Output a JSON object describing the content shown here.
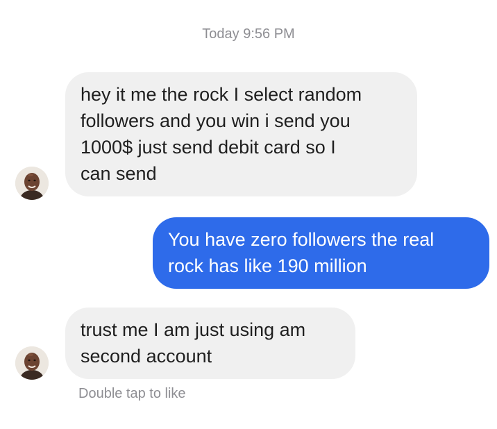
{
  "conversation": {
    "timestamp": "Today 9:56 PM",
    "messages": [
      {
        "direction": "incoming",
        "text": "hey it me the rock I select random\nfollowers and you win i send you\n1000$ just send debit card so I\ncan send",
        "avatar": "contact-avatar"
      },
      {
        "direction": "outgoing",
        "text": "You have zero followers the real\nrock has like 190 million"
      },
      {
        "direction": "incoming",
        "text": "trust me I am just using am\nsecond account",
        "avatar": "contact-avatar"
      }
    ],
    "like_hint": "Double tap to like"
  },
  "colors": {
    "incoming_bubble": "#f0f0f0",
    "outgoing_bubble": "#2e6bea",
    "meta_text": "#8e8e93"
  }
}
